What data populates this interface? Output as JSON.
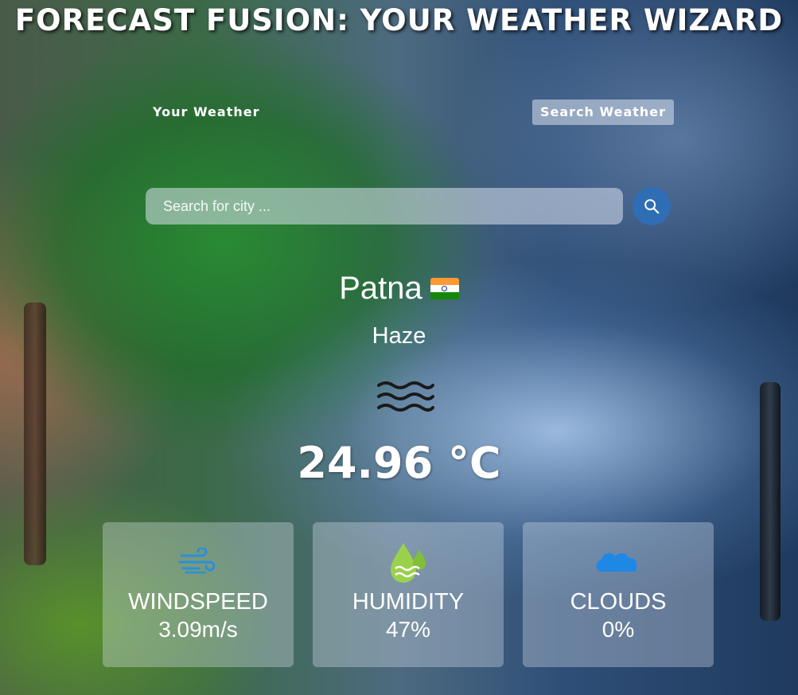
{
  "header": {
    "title": "FORECAST FUSION: YOUR WEATHER WIZARD"
  },
  "nav": {
    "tabs": [
      {
        "label": "Your Weather",
        "active": false
      },
      {
        "label": "Search Weather",
        "active": true
      }
    ]
  },
  "search": {
    "placeholder": "Search for city ...",
    "value": "",
    "button_icon": "search-icon"
  },
  "weather": {
    "city": "Patna",
    "country_flag": "india-flag-icon",
    "description": "Haze",
    "icon": "haze-icon",
    "temperature": "24.96 °C"
  },
  "cards": [
    {
      "label": "WINDSPEED",
      "value": "3.09m/s",
      "icon": "wind-icon"
    },
    {
      "label": "HUMIDITY",
      "value": "47%",
      "icon": "humidity-icon"
    },
    {
      "label": "CLOUDS",
      "value": "0%",
      "icon": "cloud-icon"
    }
  ],
  "colors": {
    "search_button": "#2f6db5",
    "wind_icon": "#2a8fd8",
    "humidity_icon": "#9ad14a",
    "cloud_icon": "#1e88e5"
  }
}
